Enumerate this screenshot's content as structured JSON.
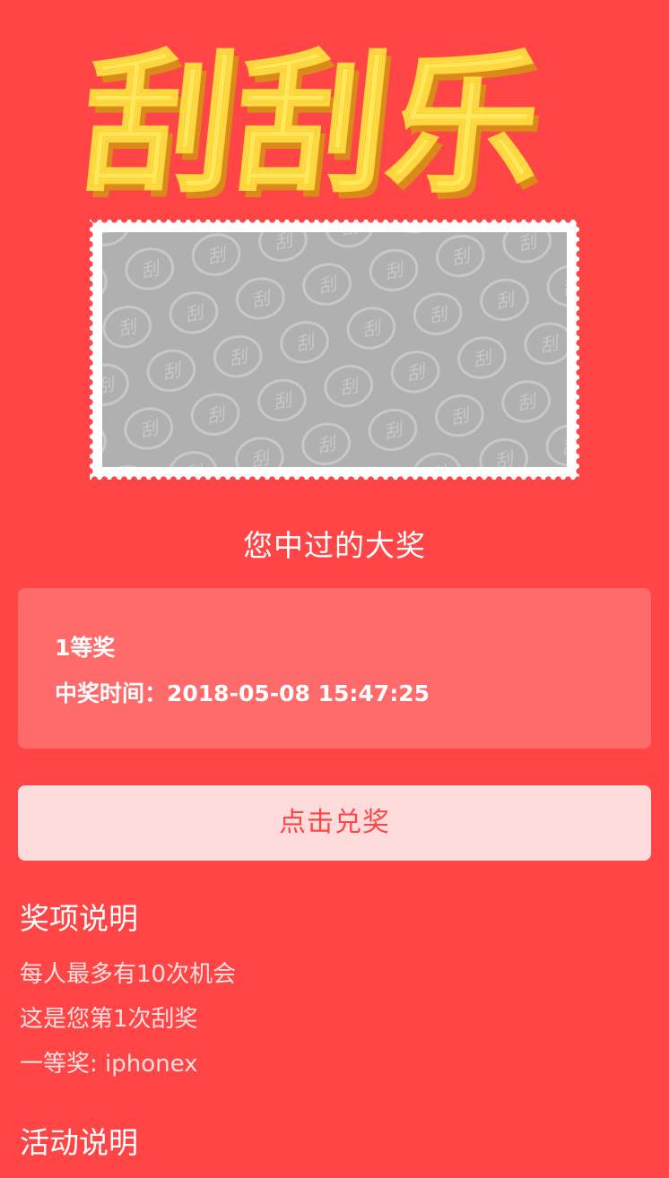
{
  "logo": {
    "text": "刮刮乐",
    "colors": {
      "face": "#ffe95a",
      "shadow": "#e0a020"
    }
  },
  "scratch_card": {
    "pattern_glyph": "刮",
    "cover_color": "#b0b0b0",
    "frame_color": "#ffffff"
  },
  "winners": {
    "title": "您中过的大奖",
    "prize_name": "1等奖",
    "prize_time": "中奖时间：2018-05-08 15:47:25"
  },
  "redeem": {
    "label": "点击兑奖"
  },
  "prize_rules": {
    "title": "奖项说明",
    "lines": [
      "每人最多有10次机会",
      "这是您第1次刮奖",
      "一等奖: iphonex"
    ]
  },
  "activity_rules": {
    "title": "活动说明"
  },
  "colors": {
    "background": "#ff4545",
    "card": "#ff6b6b",
    "button": "#ffdcdc",
    "button_text": "#ff4545"
  }
}
